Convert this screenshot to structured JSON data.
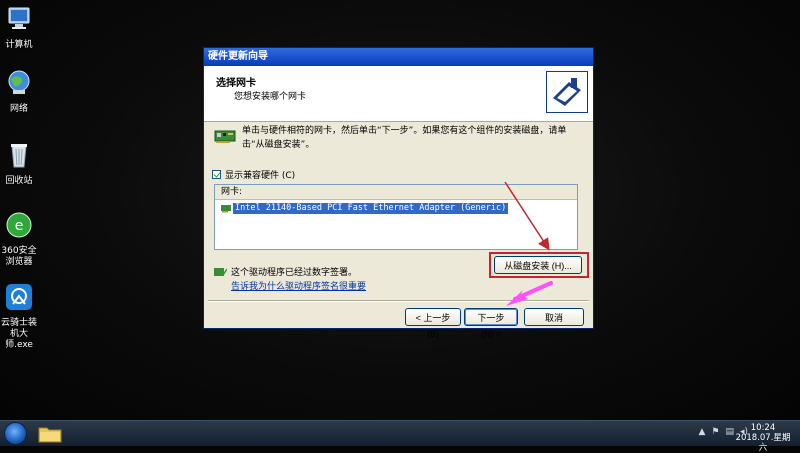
{
  "desktop": {
    "icons": [
      {
        "label": "计算机"
      },
      {
        "label": "网络"
      },
      {
        "label": "回收站"
      },
      {
        "label": "360安全浏览器"
      },
      {
        "label": "云骑士装机大师.exe"
      }
    ]
  },
  "dialog": {
    "title": "硬件更新向导",
    "header_title": "选择网卡",
    "header_subtitle": "您想安装哪个网卡",
    "instruction": "单击与硬件相符的网卡，然后单击“下一步”。如果您有这个组件的安装磁盘，请单击“从磁盘安装”。",
    "show_compatible_label": "显示兼容硬件 (C)",
    "show_compatible_checked": true,
    "list_header": "网卡:",
    "list_items": [
      "Intel 21140-Based PCI Fast Ethernet Adapter (Generic)"
    ],
    "signed_text": "这个驱动程序已经过数字签署。",
    "signed_link": "告诉我为什么驱动程序签名很重要",
    "buttons": {
      "have_disk": "从磁盘安装 (H)...",
      "back": "< 上一步 (B)",
      "next": "下一步 (N) >",
      "cancel": "取消"
    }
  },
  "colors": {
    "titlebar": "#0a3bb8",
    "highlight_frame": "#c1272d",
    "annotation_arrow": "#ff4fff",
    "selection": "#316ac5"
  },
  "taskbar": {
    "clock_time": "10:24",
    "clock_date": "2018.07.星期六"
  }
}
